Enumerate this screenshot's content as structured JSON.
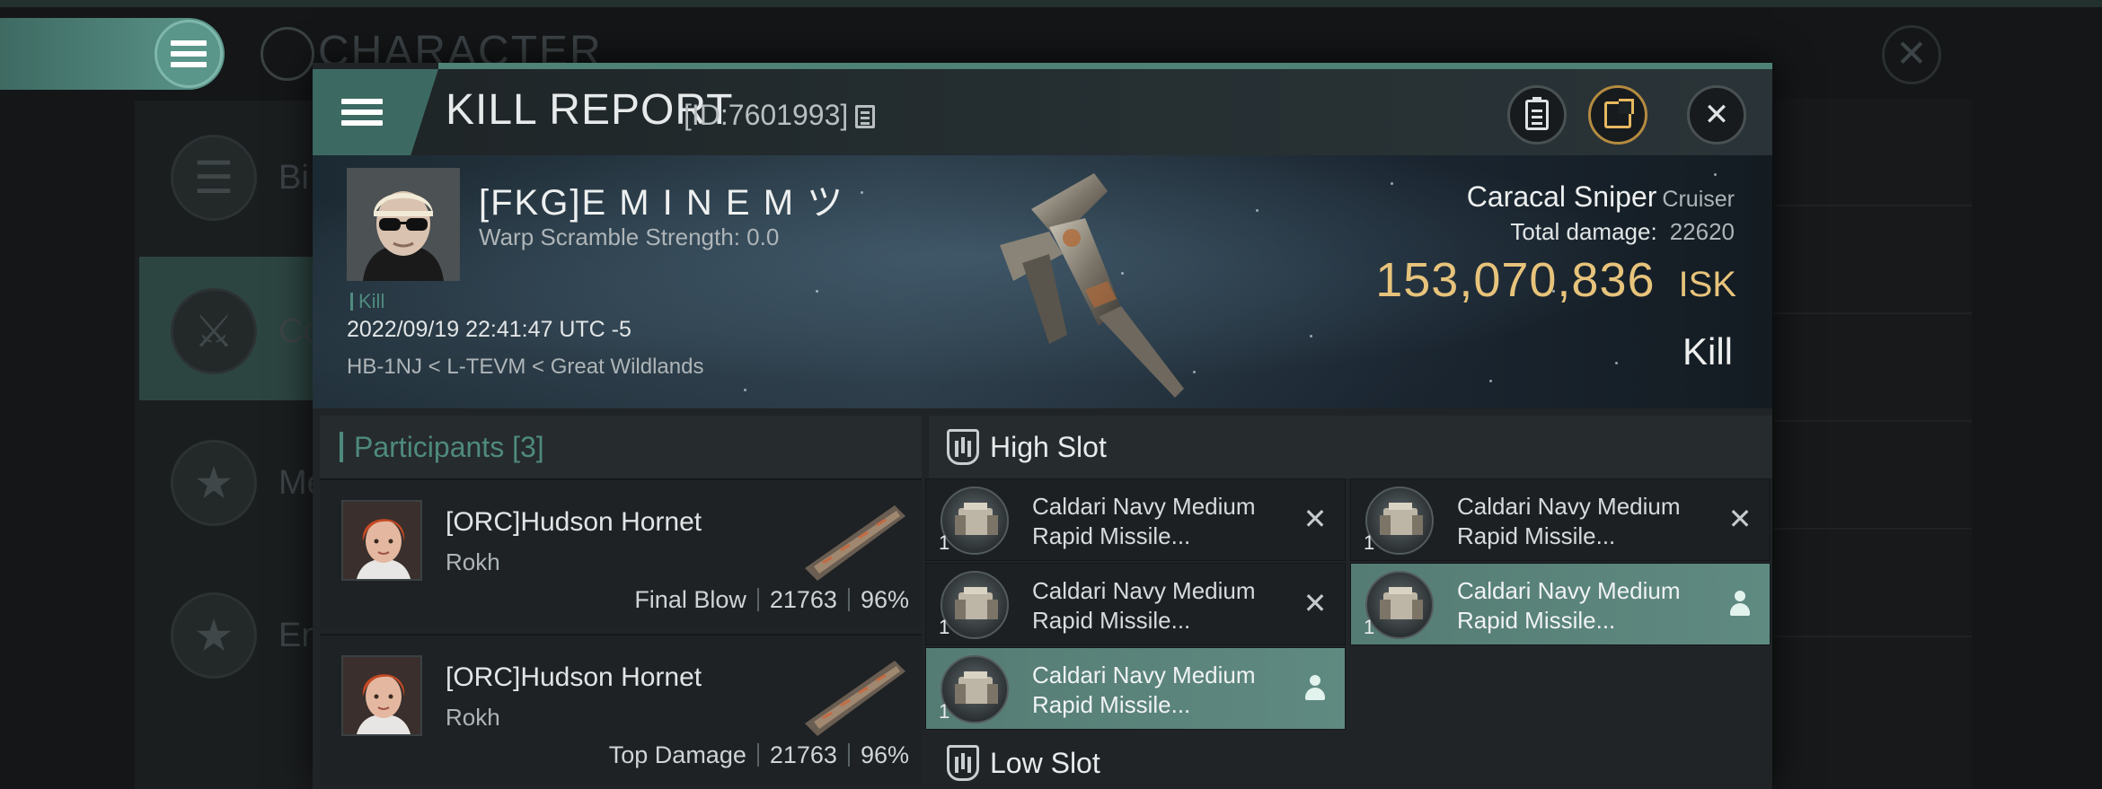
{
  "background_screen": {
    "title": "CHARACTER",
    "sidebar_items": [
      "Bi",
      "Co",
      "Me",
      "En"
    ]
  },
  "window": {
    "title": "KILL REPORT",
    "id_label": "[ID:7601993]"
  },
  "victim": {
    "pilot": "[FKG]E M I N E M ツ",
    "warp_scramble": "Warp Scramble Strength: 0.0",
    "tag": "Kill",
    "datetime": "2022/09/19 22:41:47 UTC -5",
    "location": "HB-1NJ < L-TEVM < Great Wildlands",
    "ship_name": "Caracal Sniper",
    "ship_class": "Cruiser",
    "total_damage_label": "Total damage:",
    "total_damage": "22620",
    "isk_value": "153,070,836",
    "isk_unit": "ISK",
    "outcome": "Kill"
  },
  "participants": {
    "label": "Participants",
    "count": "[3]",
    "rows": [
      {
        "name": "[ORC]Hudson Hornet",
        "ship": "Rokh",
        "role": "Final Blow",
        "damage": "21763",
        "percent": "96%"
      },
      {
        "name": "[ORC]Hudson Hornet",
        "ship": "Rokh",
        "role": "Top Damage",
        "damage": "21763",
        "percent": "96%"
      }
    ]
  },
  "slots": {
    "high": {
      "label": "High Slot",
      "modules": [
        {
          "qty": "1",
          "line1": "Caldari Navy Medium",
          "line2": "Rapid Missile...",
          "state": "destroyed"
        },
        {
          "qty": "1",
          "line1": "Caldari Navy Medium",
          "line2": "Rapid Missile...",
          "state": "destroyed"
        },
        {
          "qty": "1",
          "line1": "Caldari Navy Medium",
          "line2": "Rapid Missile...",
          "state": "destroyed"
        },
        {
          "qty": "1",
          "line1": "Caldari Navy Medium",
          "line2": "Rapid Missile...",
          "state": "dropped"
        },
        {
          "qty": "1",
          "line1": "Caldari Navy Medium",
          "line2": "Rapid Missile...",
          "state": "dropped"
        }
      ]
    },
    "low": {
      "label": "Low Slot"
    }
  },
  "icons": {
    "menu": "hamburger-icon",
    "clipboard": "clipboard-icon",
    "share": "share-icon",
    "close": "close-icon",
    "copy": "copy-icon",
    "destroyed": "x-icon",
    "dropped": "person-icon"
  },
  "colors": {
    "accent_teal": "#4f8a7e",
    "isk_gold": "#e7c37b",
    "fitted_module": "#5a857c",
    "share_accent": "#e8b860"
  }
}
